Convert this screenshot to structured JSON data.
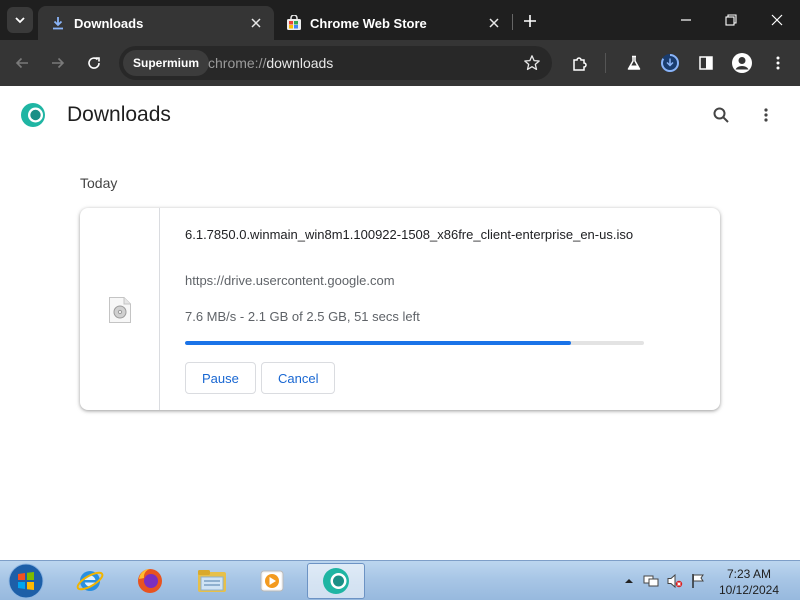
{
  "tabs": [
    {
      "label": "Downloads",
      "favicon": "download-icon",
      "active": true
    },
    {
      "label": "Chrome Web Store",
      "favicon": "web-store-icon",
      "active": false
    }
  ],
  "toolbar": {
    "profile_chip": "Supermium",
    "url_scheme": "chrome://",
    "url_path": "downloads"
  },
  "page": {
    "title": "Downloads",
    "section": "Today"
  },
  "download": {
    "filename": "6.1.7850.0.winmain_win8m1.100922-1508_x86fre_client-enterprise_en-us.iso",
    "source": "https://drive.usercontent.google.com",
    "status": "7.6 MB/s - 2.1 GB of 2.5 GB, 51 secs left",
    "progress_percent": 84,
    "pause_label": "Pause",
    "cancel_label": "Cancel"
  },
  "taskbar": {
    "apps": [
      "internet-explorer-icon",
      "firefox-icon",
      "file-explorer-icon",
      "media-player-icon",
      "supermium-icon"
    ],
    "time": "7:23 AM",
    "date": "10/12/2024"
  },
  "colors": {
    "accent": "#1a73e8",
    "button_text": "#1967d2",
    "tabstrip": "#1f1f1f",
    "toolbar": "#353535"
  }
}
